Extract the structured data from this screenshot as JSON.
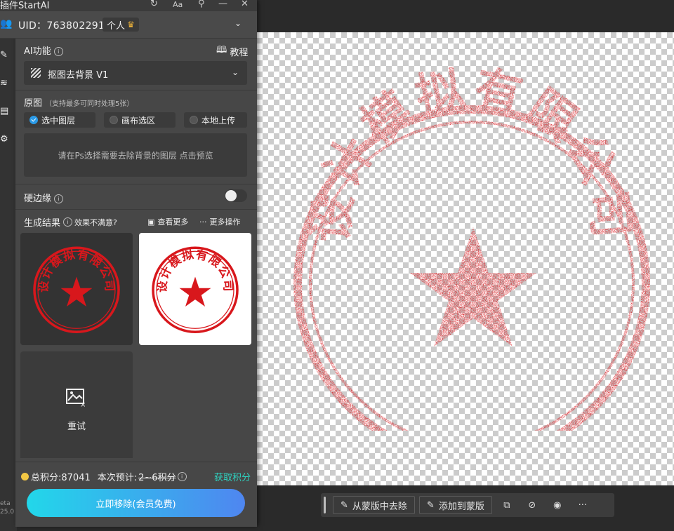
{
  "app": {
    "title": "插件StartAI",
    "uid_label": "UID：763802291",
    "plan_badge": "个人"
  },
  "sidebar_strip": {
    "beta_line1": "eta",
    "beta_line2": "25.0",
    "icons": [
      "edit-icon",
      "layers-icon",
      "document-icon",
      "gear-icon"
    ]
  },
  "ai_function": {
    "title": "AI功能",
    "tutorial": "教程",
    "selected": "抠图去背景 V1"
  },
  "source": {
    "title": "原图",
    "hint": "（支持最多可同时处理5张）",
    "options": [
      "选中图层",
      "画布选区",
      "本地上传"
    ],
    "selected_index": 0,
    "preview_hint": "请在Ps选择需要去除背景的图层 点击预览"
  },
  "hard_edge": {
    "label": "硬边缘",
    "enabled": false
  },
  "results": {
    "title": "生成结果",
    "hint": "效果不满意?",
    "view_more": "查看更多",
    "more_ops": "更多操作",
    "retry": "重试"
  },
  "footer": {
    "points_label": "总积分:87041",
    "estimate_label": "本次预计:",
    "estimate_value": "2~6积分",
    "get_points": "获取积分",
    "remove_button": "立即移除(会员免费)"
  },
  "stamp": {
    "text": "设计模拟有限公司",
    "color": "#d8171c"
  },
  "bottom_toolbar": {
    "remove_from_mask": "从蒙版中去除",
    "add_to_mask": "添加到蒙版",
    "more": "···"
  }
}
